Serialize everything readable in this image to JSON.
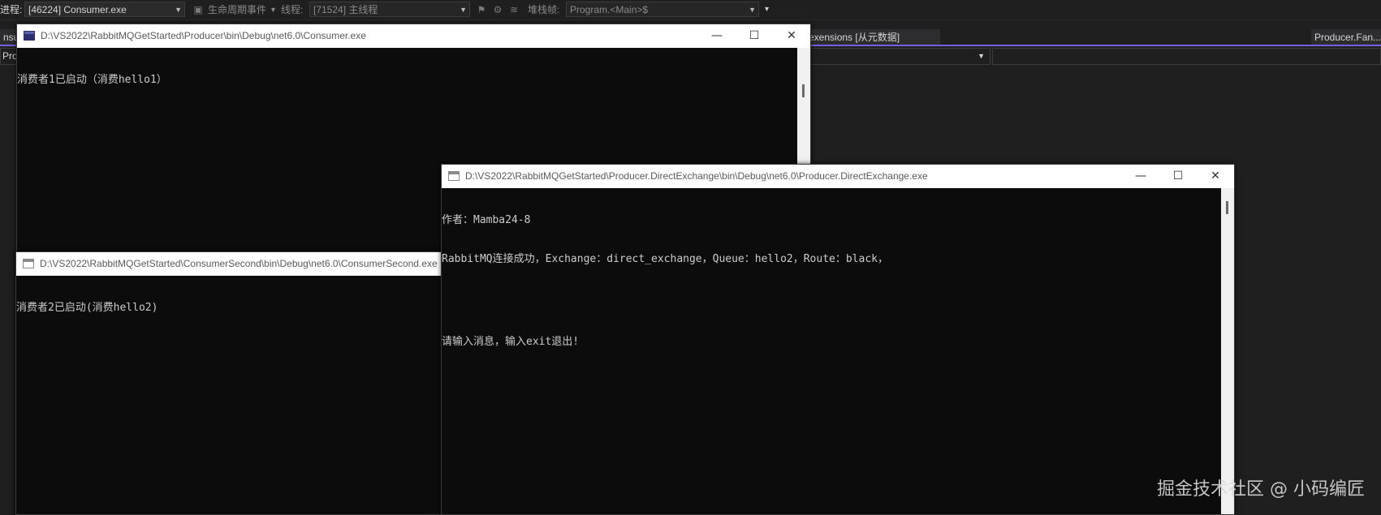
{
  "toolbar": {
    "process_label": "进程:",
    "process_value": "[46224] Consumer.exe",
    "lifecycle_label": "生命周期事件",
    "thread_label": "线程:",
    "thread_value": "[71524] 主线程",
    "stack_label": "堆栈帧:",
    "stack_value": "Program.<Main>$"
  },
  "doc_tabs": {
    "left_fragment": "nsu",
    "middle": "exensions [从元数据]",
    "right": "Producer.Fan..."
  },
  "nav": {
    "left_fragment": "Pro"
  },
  "windows": {
    "consumer": {
      "title": "D:\\VS2022\\RabbitMQGetStarted\\Producer\\bin\\Debug\\net6.0\\Consumer.exe",
      "lines": [
        "消费者1已启动（消费hello1）"
      ]
    },
    "consumer_second": {
      "title": "D:\\VS2022\\RabbitMQGetStarted\\ConsumerSecond\\bin\\Debug\\net6.0\\ConsumerSecond.exe",
      "lines": [
        "消费者2已启动(消费hello2)"
      ]
    },
    "producer": {
      "title": "D:\\VS2022\\RabbitMQGetStarted\\Producer.DirectExchange\\bin\\Debug\\net6.0\\Producer.DirectExchange.exe",
      "lines": [
        "作者：Mamba24-8",
        "RabbitMQ连接成功，Exchange：direct_exchange，Queue：hello2，Route：black，",
        "",
        "请输入消息，输入exit退出!"
      ]
    }
  },
  "window_buttons": {
    "minimize": "—",
    "maximize": "☐",
    "close": "✕"
  },
  "watermark": "掘金技术社区 @ 小码编匠"
}
